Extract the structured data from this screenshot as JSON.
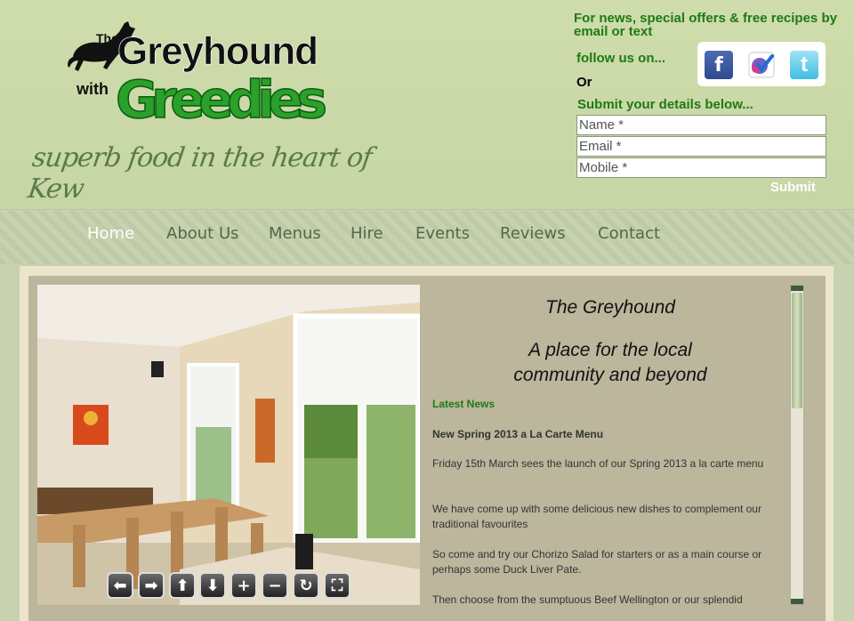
{
  "logo": {
    "text_the": "The",
    "text_greyhound": "Greyhound",
    "text_with": "with",
    "text_greedies": "Greedies"
  },
  "tagline": "superb food in the heart of Kew",
  "signup": {
    "heading": "For news, special offers & free recipes by email or text",
    "follow": "follow us on...",
    "or": "Or",
    "submit_details": "Submit your details below...",
    "name_placeholder": "Name *",
    "email_placeholder": "Email *",
    "mobile_placeholder": "Mobile *",
    "submit": "Submit"
  },
  "social": [
    {
      "icon": "facebook-icon",
      "glyph": "f"
    },
    {
      "icon": "foursquare-icon",
      "glyph": ""
    },
    {
      "icon": "twitter-icon",
      "glyph": "t"
    }
  ],
  "nav": {
    "items": [
      {
        "label": "Home",
        "active": true
      },
      {
        "label": "About Us"
      },
      {
        "label": "Menus"
      },
      {
        "label": "Hire"
      },
      {
        "label": "Events"
      },
      {
        "label": "Reviews"
      },
      {
        "label": "Contact"
      }
    ]
  },
  "panorama_controls": [
    {
      "icon": "pan-left-icon",
      "glyph": "⬅"
    },
    {
      "icon": "pan-right-icon",
      "glyph": "➡"
    },
    {
      "icon": "pan-up-icon",
      "glyph": "⬆"
    },
    {
      "icon": "pan-down-icon",
      "glyph": "⬇"
    },
    {
      "icon": "zoom-in-icon",
      "glyph": "+"
    },
    {
      "icon": "zoom-out-icon",
      "glyph": "−"
    },
    {
      "icon": "rotate-icon",
      "glyph": "↻"
    },
    {
      "icon": "fullscreen-icon",
      "glyph": "⛶"
    }
  ],
  "main": {
    "title1": "The Greyhound",
    "title2_line1": "A place for the local",
    "title2_line2": "community and beyond",
    "latest": "Latest News",
    "news_title": "New Spring 2013 a La Carte Menu",
    "para1": "Friday 15th March sees the launch of our Spring 2013 a la carte menu",
    "para2": "We have come up with some delicious new dishes to complement our traditional favourites",
    "para3": "So come and try our Chorizo Salad for starters or as a main course or perhaps some Duck Liver Pate.",
    "para4": "Then choose from the sumptuous Beef Wellington or our splendid"
  },
  "colors": {
    "green_text": "#1e7a14",
    "nav_text": "#4f6a47",
    "header_bg": "#cfdcab"
  }
}
